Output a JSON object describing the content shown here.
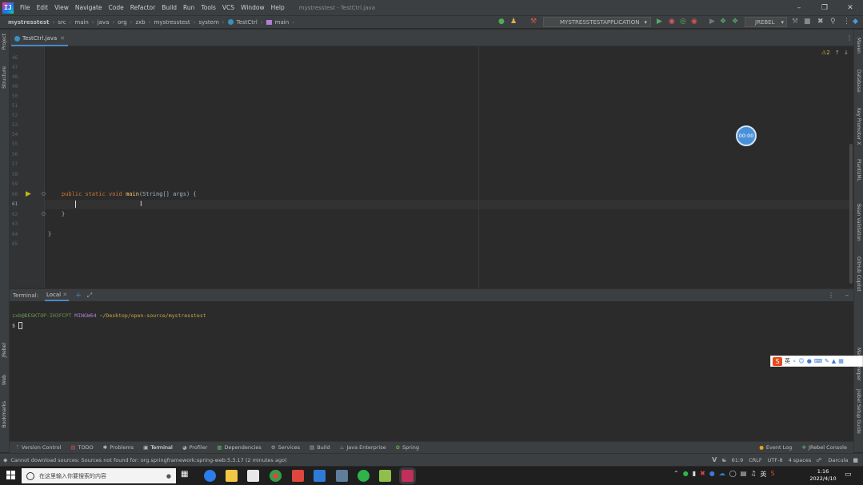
{
  "menubar": {
    "items": [
      "File",
      "Edit",
      "View",
      "Navigate",
      "Code",
      "Refactor",
      "Build",
      "Run",
      "Tools",
      "VCS",
      "Window",
      "Help"
    ],
    "window_title": "mystresstest - TestCtrl.java"
  },
  "breadcrumb": [
    "mystresstest",
    "src",
    "main",
    "java",
    "org",
    "zxb",
    "mystresstest",
    "system",
    "TestCtrl",
    "main"
  ],
  "toolbar": {
    "run_config": "MYSTRESSTESTAPPLICATION",
    "jrebel": "JREBEL"
  },
  "left_strip": [
    "Project",
    "Structure",
    "JRebel",
    "Web",
    "Bookmarks"
  ],
  "right_strip": [
    "Maven",
    "Database",
    "Key Promoter X",
    "PlantUML",
    "Bean Validation",
    "GitHub Copilot",
    "Maven Helper",
    "Jrebel Setup Guide"
  ],
  "editor": {
    "tab": "TestCtrl.java",
    "warning_count": "2",
    "line_numbers": [
      "46",
      "47",
      "48",
      "49",
      "50",
      "51",
      "52",
      "53",
      "54",
      "55",
      "56",
      "57",
      "58",
      "59",
      "60",
      "61",
      "62",
      "63",
      "64",
      "65"
    ],
    "code": {
      "line60_kw": "public static void ",
      "line60_fn": "main",
      "line60_rest": "(String[] args) {",
      "line62": "}",
      "line64": "}"
    }
  },
  "timer": "00:00",
  "terminal": {
    "title": "Terminal:",
    "tab": "Local",
    "prompt_user": "zxb@DESKTOP-IH3FCPT",
    "prompt_shell": "MINGW64",
    "prompt_path": "~/Desktop/open-source/mystresstest",
    "prompt_symbol": "$"
  },
  "ime": {
    "lang": "英"
  },
  "tool_windows": {
    "left": [
      "Version Control",
      "TODO",
      "Problems",
      "Terminal",
      "Profiler",
      "Dependencies",
      "Services",
      "Build",
      "Java Enterprise",
      "Spring"
    ],
    "right": [
      "Event Log",
      "JRebel Console"
    ]
  },
  "statusbar": {
    "message": "Cannot download sources: Sources not found for: org.springframework:spring-web:5.3.17 (2 minutes ago)",
    "position": "61:9",
    "line_sep": "CRLF",
    "encoding": "UTF-8",
    "indent": "4 spaces",
    "theme": "Darcula"
  },
  "taskbar": {
    "search_placeholder": "在这里输入你要搜索的内容",
    "time": "1:16",
    "date": "2022/4/10",
    "lang": "英"
  },
  "colors": {
    "keyword": "#cc7832",
    "function": "#ffc66d",
    "accent": "#4a88c7",
    "prompt": "#6a9955"
  }
}
